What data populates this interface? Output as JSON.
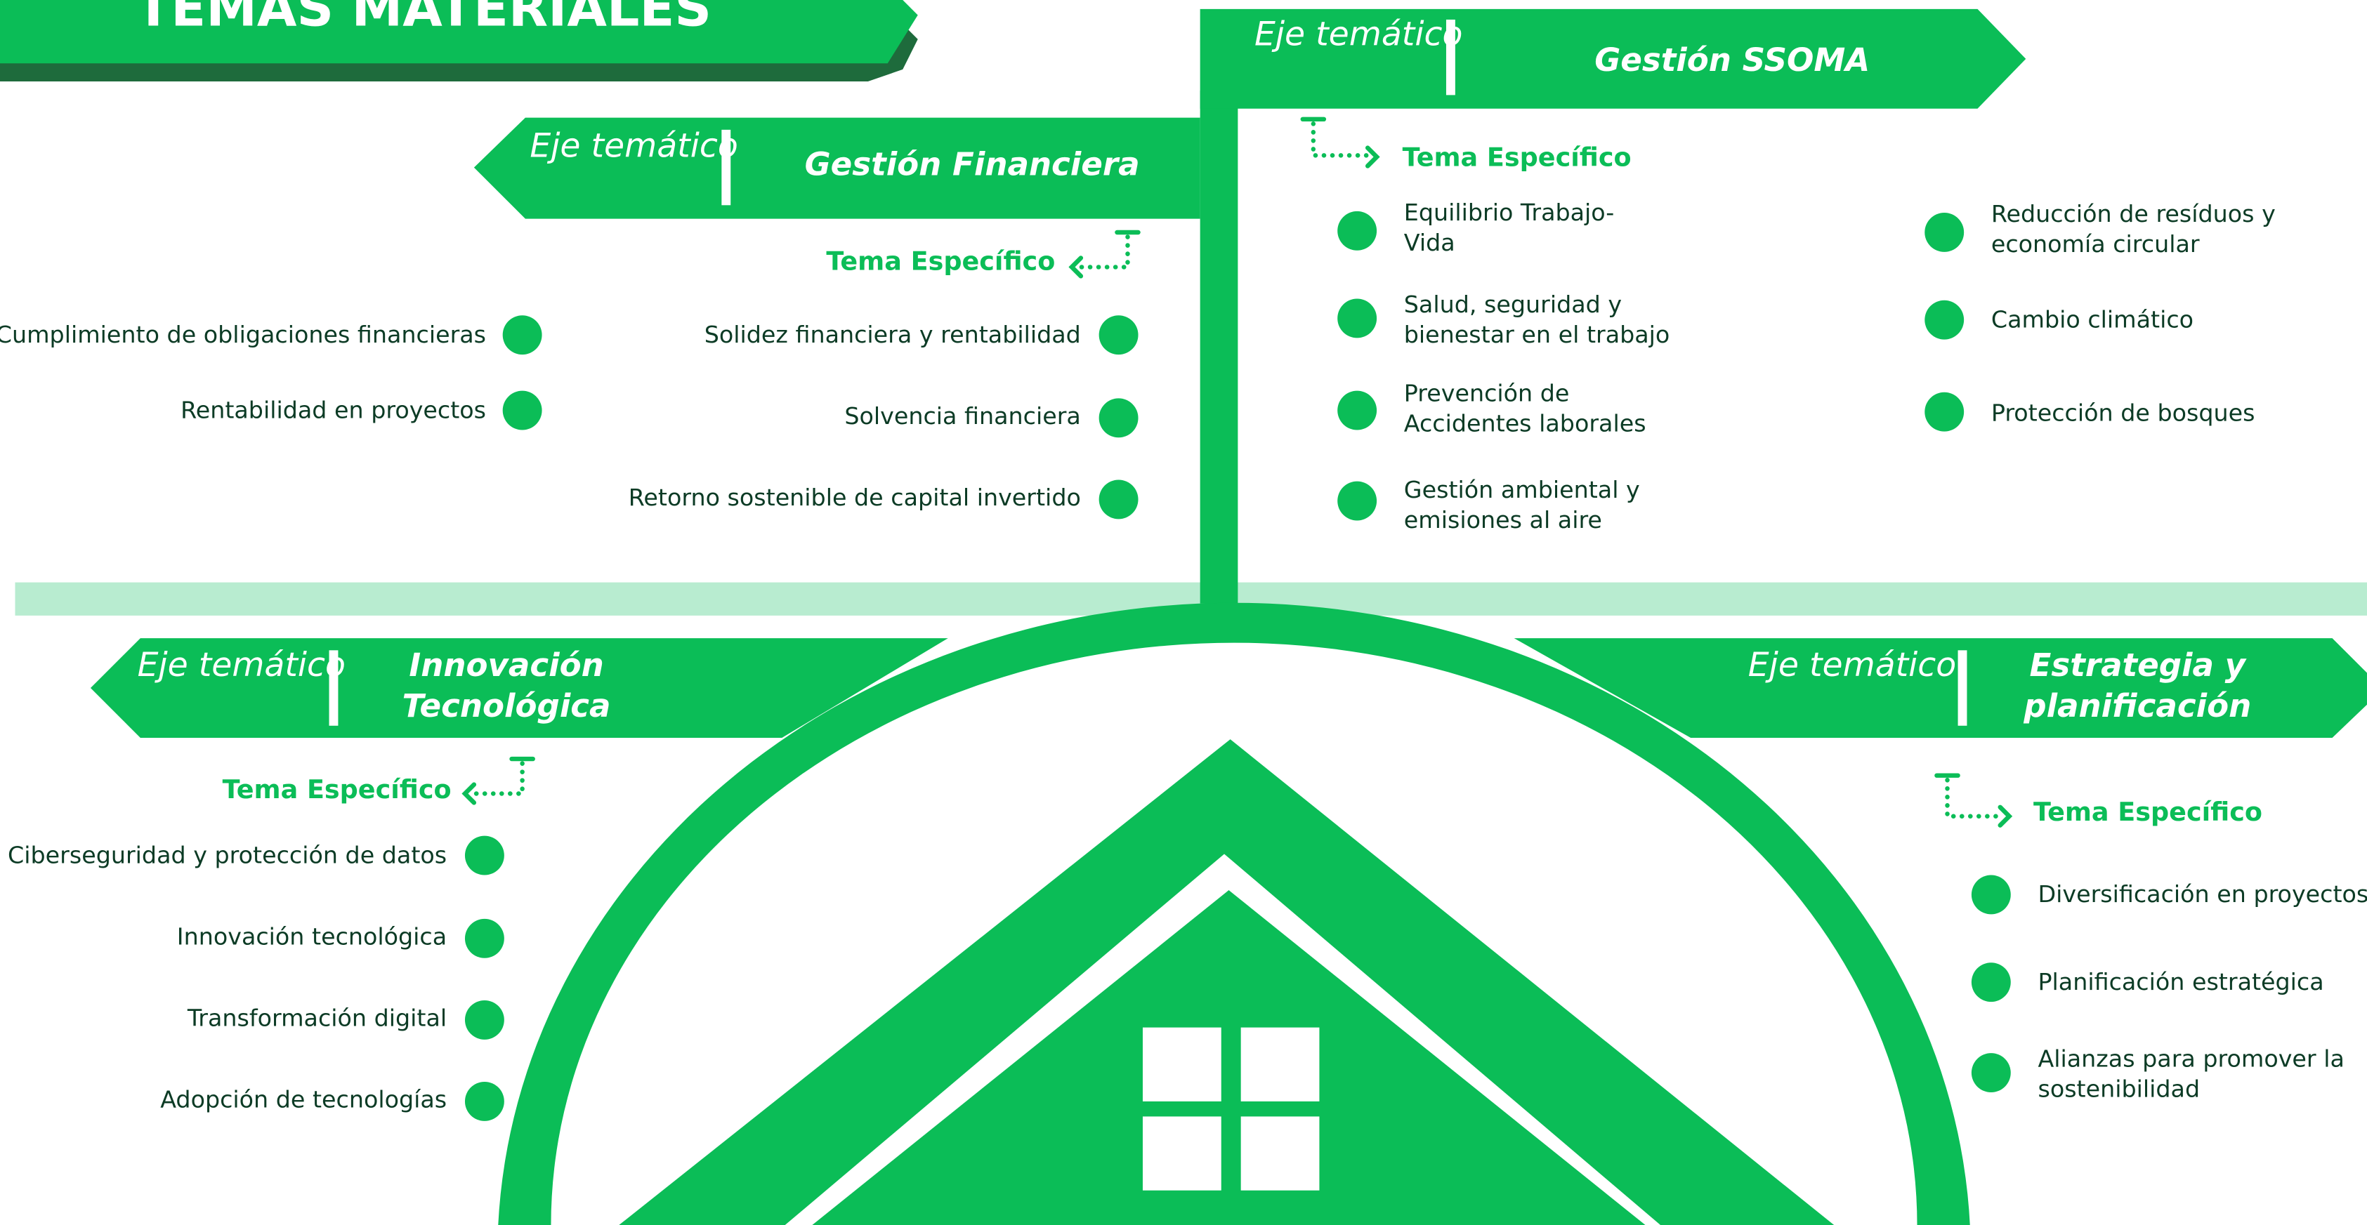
{
  "title": "TEMAS MATERIALES",
  "colors": {
    "primary": "#0bbd57",
    "dark": "#1e6b3c",
    "band": "#b8ecd0",
    "text": "#0c3b25"
  },
  "axis_label": "Eje temático",
  "axes": [
    {
      "name": "Gestión Financiera",
      "tema": "Tema Específico",
      "topics": [
        "Cumplimiento de obligaciones financieras",
        "Rentabilidad en proyectos",
        "Solidez financiera y rentabilidad",
        "Solvencia financiera",
        "Retorno sostenible de capital invertido"
      ]
    },
    {
      "name": "Gestión SSOMA",
      "tema": "Tema Específico",
      "topics": [
        "Equilibrio Trabajo-Vida",
        "Salud, seguridad y bienestar en el trabajo",
        "Prevención de Accidentes laborales",
        "Gestión ambiental y emisiones al aire",
        "Reducción de resíduos y economía circular",
        "Cambio climático",
        "Protección de bosques"
      ]
    },
    {
      "name": "Innovación Tecnológica",
      "tema": "Tema Específico",
      "topics": [
        "Ciberseguridad y protección de datos",
        "Innovación tecnológica",
        "Transformación digital",
        "Adopción de tecnologías"
      ]
    },
    {
      "name": "Estrategia y planificación",
      "tema": "Tema Específico",
      "topics": [
        "Diversificación en proyectos",
        "Planificación estratégica",
        "Alianzas para promover la sostenibilidad"
      ]
    }
  ]
}
